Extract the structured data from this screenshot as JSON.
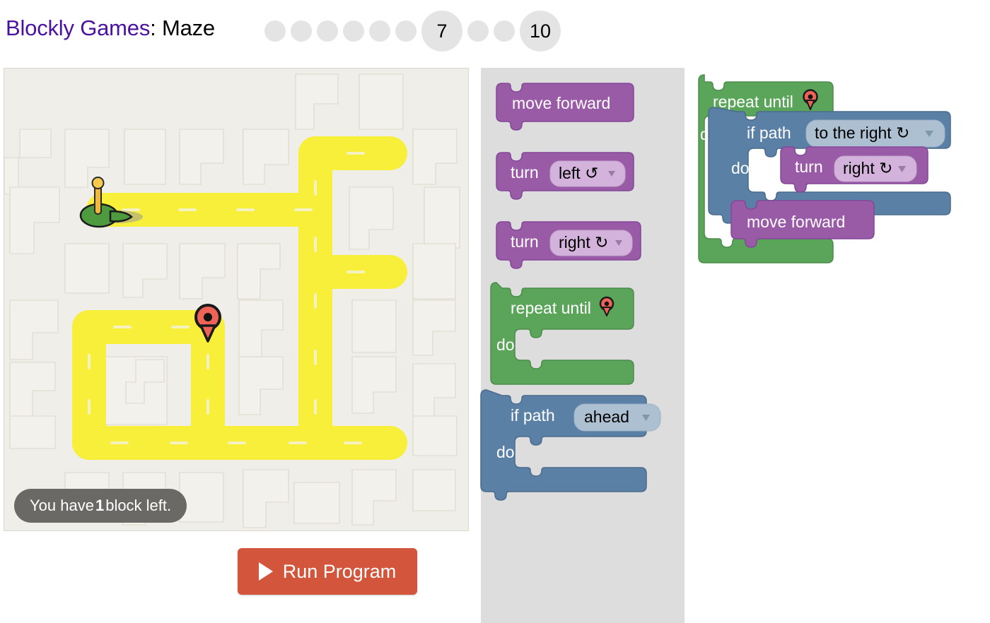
{
  "header": {
    "brand": "Blockly Games",
    "separator": ":",
    "level_name": "Maze",
    "levels": [
      {
        "label": "",
        "current": false
      },
      {
        "label": "",
        "current": false
      },
      {
        "label": "",
        "current": false
      },
      {
        "label": "",
        "current": false
      },
      {
        "label": "",
        "current": false
      },
      {
        "label": "",
        "current": false
      },
      {
        "label": "7",
        "current": true
      },
      {
        "label": "",
        "current": false
      },
      {
        "label": "",
        "current": false
      },
      {
        "label": "10",
        "current": true
      }
    ]
  },
  "maze": {
    "status_prefix": "You have ",
    "status_count": "1",
    "status_suffix": " block left.",
    "run_button_label": "Run Program",
    "run_icon": "play-icon",
    "pegman_icon": "pegman-icon",
    "marker_icon": "map-pin-icon",
    "background_color": "#efeee9",
    "path_color": "#f7ef3a",
    "wall_color": "#f2f1ec",
    "marker_color": "#ee6357"
  },
  "toolbox": {
    "blocks": [
      {
        "id": "move-forward",
        "type": "statement",
        "color": "#9a5ba6",
        "label": "move forward",
        "fields": []
      },
      {
        "id": "turn-left",
        "type": "statement",
        "color": "#9a5ba6",
        "label": "turn",
        "fields": [
          {
            "value": "left ↺",
            "dropdown": true
          }
        ]
      },
      {
        "id": "turn-right",
        "type": "statement",
        "color": "#9a5ba6",
        "label": "turn",
        "fields": [
          {
            "value": "right ↻",
            "dropdown": true
          }
        ]
      },
      {
        "id": "repeat-until",
        "type": "loop",
        "color": "#5ba55b",
        "label": "repeat until",
        "sublabel": "do",
        "icon": "map-pin-icon",
        "fields": []
      },
      {
        "id": "if-path-ahead",
        "type": "conditional",
        "color": "#5b80a5",
        "label": "if path",
        "sublabel": "do",
        "fields": [
          {
            "value": "ahead",
            "dropdown": true
          }
        ]
      }
    ]
  },
  "workspace": {
    "program": {
      "id": "repeat-until",
      "label": "repeat until",
      "sublabel": "do",
      "icon": "map-pin-icon",
      "color": "#5ba55b",
      "children": [
        {
          "id": "if-path",
          "label": "if path",
          "sublabel": "do",
          "color": "#5b80a5",
          "field": "to the right ↻",
          "children": [
            {
              "id": "turn-right",
              "label": "turn",
              "color": "#9a5ba6",
              "field": "right ↻"
            }
          ]
        },
        {
          "id": "move-forward",
          "label": "move forward",
          "color": "#9a5ba6"
        }
      ]
    }
  },
  "colors": {
    "brand_purple": "#4b11a0",
    "run_button": "#d2553c",
    "status_bg": "#6b6965",
    "toolbox_bg": "#dddddd",
    "loop_green": "#5ba55b",
    "logic_blue": "#5b80a5",
    "movement_purple": "#9a5ba6"
  }
}
